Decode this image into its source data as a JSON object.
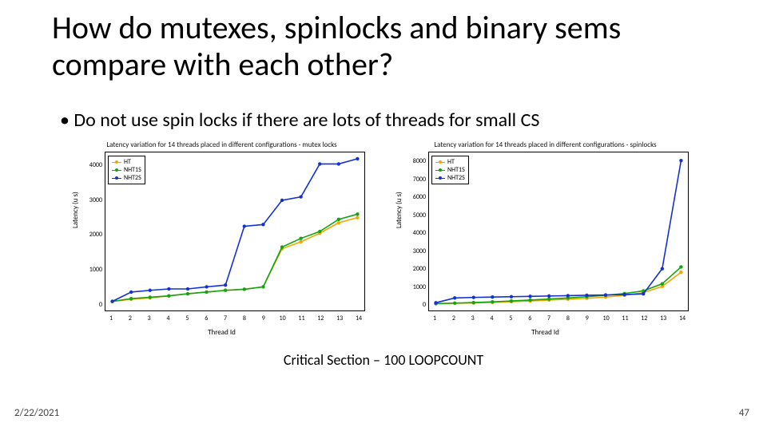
{
  "title": "How do mutexes, spinlocks and binary sems compare with each other?",
  "bullet": "Do not use spin locks if there are lots of threads for small CS",
  "caption": "Critical Section – 100 LOOPCOUNT",
  "footer": {
    "date": "2/22/2021",
    "page": "47"
  },
  "legend": {
    "items": [
      {
        "name": "HT",
        "color": "#f2a600"
      },
      {
        "name": "NHT1S",
        "color": "#12a412"
      },
      {
        "name": "NHT2S",
        "color": "#1430d0"
      }
    ]
  },
  "axes": {
    "xlabel": "Thread Id",
    "ylabel": "Latency (u s)",
    "x": [
      1,
      2,
      3,
      4,
      5,
      6,
      7,
      8,
      9,
      10,
      11,
      12,
      13,
      14
    ]
  },
  "chart_data": [
    {
      "type": "line",
      "title": "Latency variation for 14 threads placed in different configurations - mutex locks",
      "xlabel": "Thread Id",
      "ylabel": "Latency (u s)",
      "x": [
        1,
        2,
        3,
        4,
        5,
        6,
        7,
        8,
        9,
        10,
        11,
        12,
        13,
        14
      ],
      "ylim": [
        0,
        4200
      ],
      "yticks": [
        0,
        1000,
        2000,
        3000,
        4000
      ],
      "series": [
        {
          "name": "HT",
          "color": "#f2a600",
          "values": [
            80,
            140,
            180,
            240,
            300,
            350,
            400,
            430,
            500,
            1600,
            1800,
            2050,
            2350,
            2500
          ]
        },
        {
          "name": "NHT1S",
          "color": "#12a412",
          "values": [
            80,
            160,
            200,
            240,
            300,
            350,
            400,
            430,
            500,
            1650,
            1900,
            2100,
            2450,
            2600
          ]
        },
        {
          "name": "NHT2S",
          "color": "#1430d0",
          "values": [
            80,
            350,
            400,
            440,
            440,
            500,
            550,
            2250,
            2300,
            3000,
            3100,
            4050,
            4050,
            4200
          ]
        }
      ]
    },
    {
      "type": "line",
      "title": "Latency variation for 14 threads placed in different configurations - spinlocks",
      "xlabel": "Thread Id",
      "ylabel": "Latency (u s)",
      "x": [
        1,
        2,
        3,
        4,
        5,
        6,
        7,
        8,
        9,
        10,
        11,
        12,
        13,
        14
      ],
      "ylim": [
        0,
        8200
      ],
      "yticks": [
        0,
        1000,
        2000,
        3000,
        4000,
        5000,
        6000,
        7000,
        8000
      ],
      "series": [
        {
          "name": "HT",
          "color": "#f2a600",
          "values": [
            30,
            50,
            70,
            100,
            140,
            180,
            230,
            280,
            330,
            400,
            500,
            650,
            1000,
            1800
          ]
        },
        {
          "name": "NHT1S",
          "color": "#12a412",
          "values": [
            30,
            60,
            90,
            130,
            180,
            230,
            290,
            350,
            420,
            500,
            600,
            750,
            1150,
            2100
          ]
        },
        {
          "name": "NHT2S",
          "color": "#1430d0",
          "values": [
            80,
            350,
            380,
            400,
            420,
            440,
            460,
            480,
            500,
            520,
            540,
            580,
            2000,
            8100
          ]
        }
      ]
    }
  ]
}
